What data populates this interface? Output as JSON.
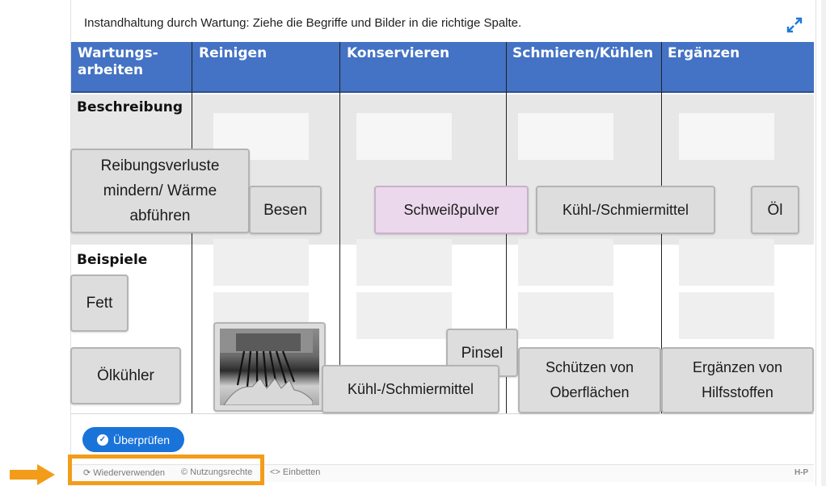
{
  "task": {
    "instruction": "Instandhaltung durch Wartung: Ziehe die Begriffe und Bilder in die richtige Spalte."
  },
  "table": {
    "headers": [
      "Wartungs-\narbeiten",
      "Reinigen",
      "Konservieren",
      "Schmieren/Kühlen",
      "Ergänzen"
    ],
    "row_labels": [
      "Beschreibung",
      "Beispiele"
    ]
  },
  "cards": [
    {
      "label": "Reibungsverluste\nmindern/ Wärme\nabführen"
    },
    {
      "label": "Besen"
    },
    {
      "label": "Schweißpulver"
    },
    {
      "label": "Kühl-/Schmiermittel"
    },
    {
      "label": "Öl"
    },
    {
      "label": "Fett"
    },
    {
      "label": "Ölkühler"
    },
    {
      "label": "Pinsel"
    },
    {
      "label": "Kühl-/Schmiermittel"
    },
    {
      "label": "Schützen von\nOberflächen"
    },
    {
      "label": "Ergänzen von\nHilfsstoffen"
    }
  ],
  "buttons": {
    "check": "Überprüfen"
  },
  "footer": {
    "reuse": "Wiederverwenden",
    "rights": "Nutzungsrechte",
    "embed": "Einbetten",
    "logo": "H-P"
  },
  "icons": {
    "fullscreen": "expand-arrows-icon",
    "check": "check-circle-icon",
    "reuse": "reuse-icon",
    "rights": "copyright-icon",
    "embed": "embed-icon"
  },
  "colors": {
    "header": "#4472c4",
    "button": "#1a73d9",
    "highlight": "#f39c1a",
    "selected_card": "#ecd8ec"
  }
}
